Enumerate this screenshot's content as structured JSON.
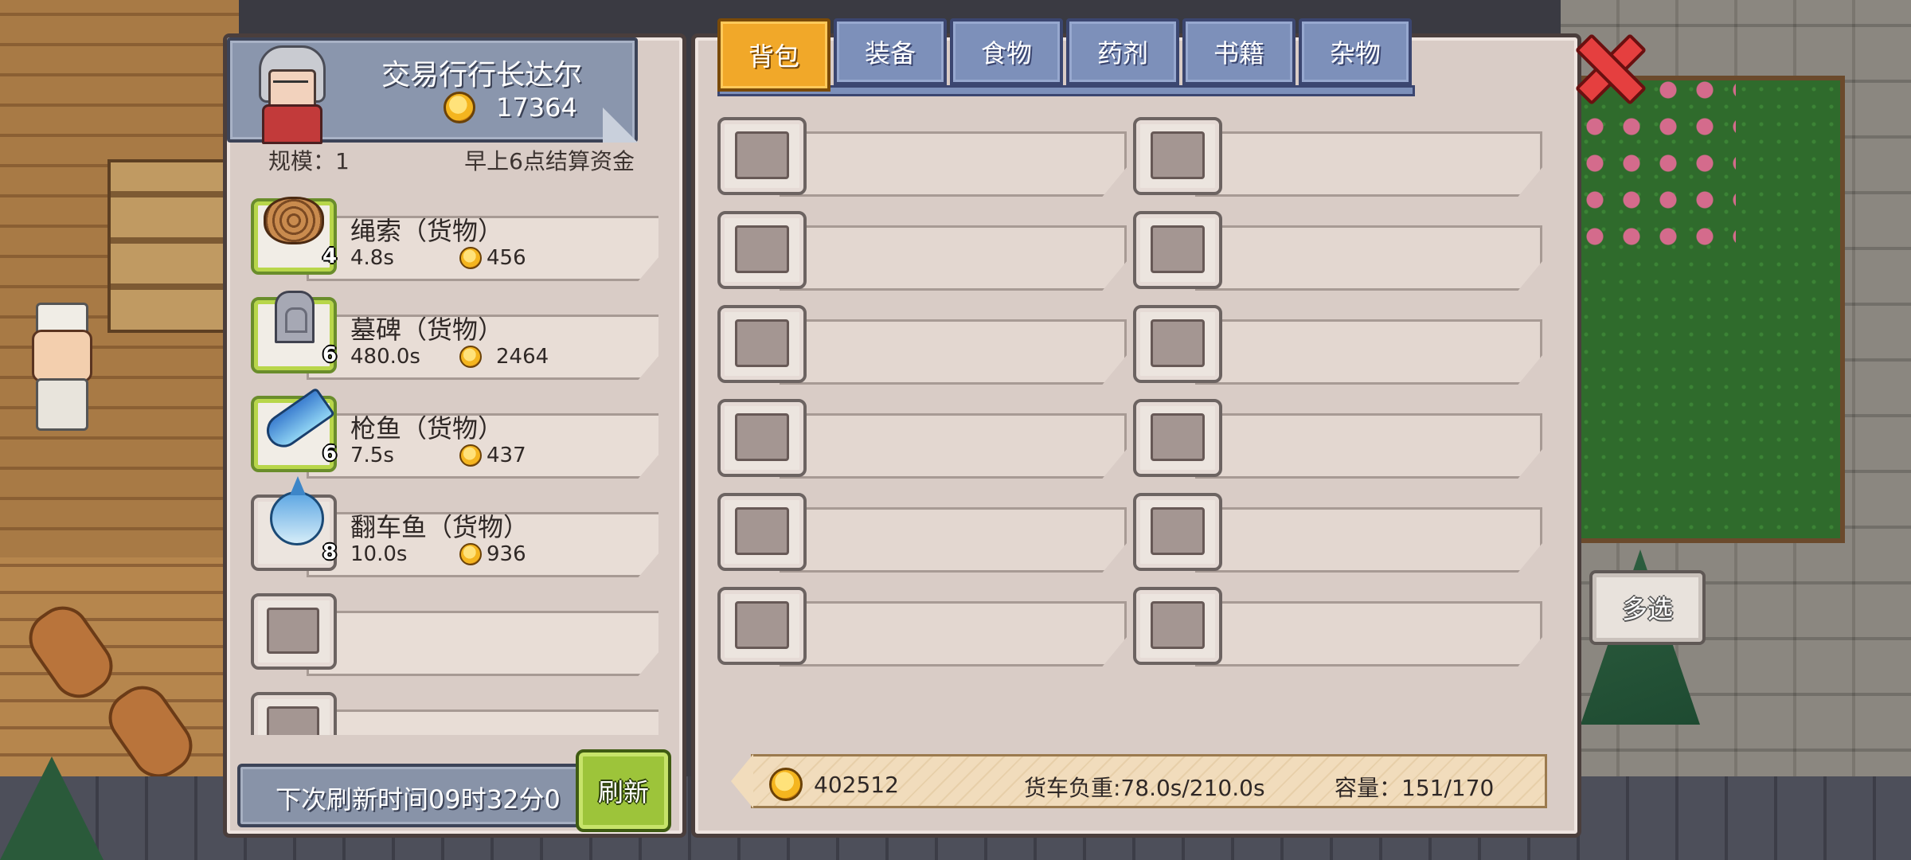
{
  "merchant": {
    "name": "交易行行长达尔",
    "gold": "17364",
    "scale": "规模：1",
    "settle_note": "早上6点结算资金"
  },
  "goods": [
    {
      "name": "绳索（货物）",
      "qty": "4",
      "time": "4.8s",
      "price": "456",
      "icon": "rope-icon"
    },
    {
      "name": "墓碑（货物）",
      "qty": "6",
      "time": "480.0s",
      "price": "2464",
      "icon": "tombstone-icon"
    },
    {
      "name": "枪鱼（货物）",
      "qty": "6",
      "time": "7.5s",
      "price": "437",
      "icon": "marlin-icon"
    },
    {
      "name": "翻车鱼（货物）",
      "qty": "8",
      "time": "10.0s",
      "price": "936",
      "icon": "sunfish-icon"
    }
  ],
  "refresh": {
    "timer_text": "下次刷新时间09时32分0",
    "button_label": "刷新"
  },
  "tabs": [
    {
      "label": "背包",
      "active": true
    },
    {
      "label": "装备",
      "active": false
    },
    {
      "label": "食物",
      "active": false
    },
    {
      "label": "药剂",
      "active": false
    },
    {
      "label": "书籍",
      "active": false
    },
    {
      "label": "杂物",
      "active": false
    }
  ],
  "status": {
    "gold": "402512",
    "weight": "货车负重:78.0s/210.0s",
    "capacity": "容量：151/170"
  },
  "multi_select_label": "多选",
  "colors": {
    "accent_tab": "#f1a829",
    "tab": "#7d90ba",
    "refresh_button": "#9dc43a",
    "close": "#e53f3f"
  }
}
